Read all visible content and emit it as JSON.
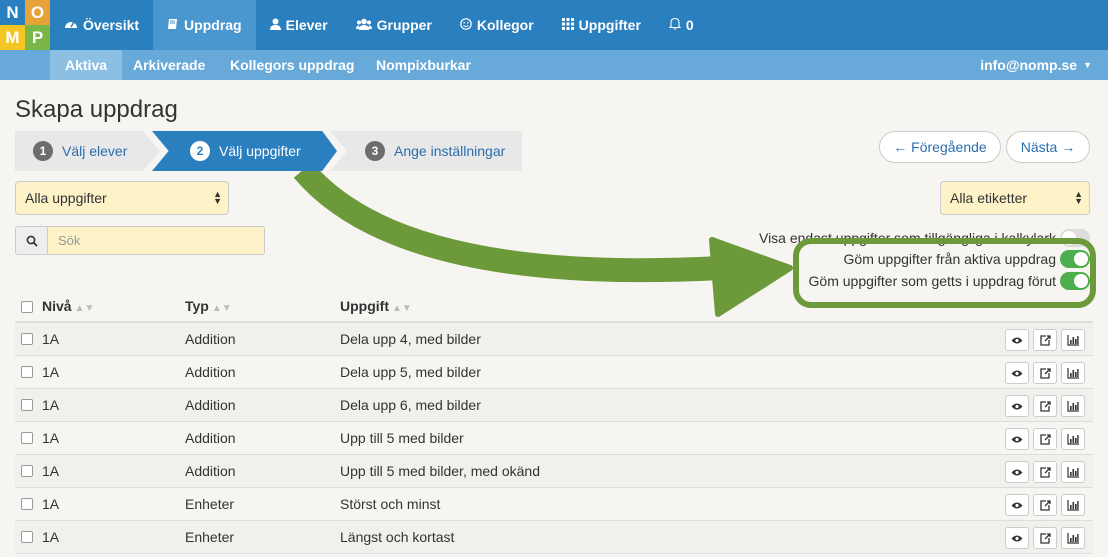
{
  "logo": {
    "letters": [
      "N",
      "O",
      "M",
      "P"
    ],
    "colors": [
      "#2a7fbf",
      "#e8a23a",
      "#f3c623",
      "#7ab648"
    ]
  },
  "nav": {
    "items": [
      {
        "label": "Översikt",
        "icon": "dashboard-icon"
      },
      {
        "label": "Uppdrag",
        "icon": "book-icon"
      },
      {
        "label": "Elever",
        "icon": "user-icon"
      },
      {
        "label": "Grupper",
        "icon": "users-icon"
      },
      {
        "label": "Kollegor",
        "icon": "smile-icon"
      },
      {
        "label": "Uppgifter",
        "icon": "grid-icon"
      },
      {
        "label": "0",
        "icon": "bell-icon"
      }
    ]
  },
  "subnav": {
    "items": [
      "Aktiva",
      "Arkiverade",
      "Kollegors uppdrag",
      "Nompixburkar"
    ],
    "user": "info@nomp.se"
  },
  "page": {
    "title": "Skapa uppdrag"
  },
  "wizard": {
    "steps": [
      {
        "num": "1",
        "label": "Välj elever"
      },
      {
        "num": "2",
        "label": "Välj uppgifter"
      },
      {
        "num": "3",
        "label": "Ange inställningar"
      }
    ],
    "prev": "← Föregående",
    "next": "Nästa →"
  },
  "filters": {
    "tasks": "Alla uppgifter",
    "tags": "Alla etiketter",
    "search_placeholder": "Sök"
  },
  "toggles": [
    {
      "label": "Visa endast uppgifter som tillgängliga i kalkylark",
      "on": false
    },
    {
      "label": "Göm uppgifter från aktiva uppdrag",
      "on": true
    },
    {
      "label": "Göm uppgifter som getts i uppdrag förut",
      "on": true
    }
  ],
  "table": {
    "headers": [
      "Nivå",
      "Typ",
      "Uppgift"
    ],
    "rows": [
      {
        "level": "1A",
        "type": "Addition",
        "task": "Dela upp 4, med bilder"
      },
      {
        "level": "1A",
        "type": "Addition",
        "task": "Dela upp 5, med bilder"
      },
      {
        "level": "1A",
        "type": "Addition",
        "task": "Dela upp 6, med bilder"
      },
      {
        "level": "1A",
        "type": "Addition",
        "task": "Upp till 5 med bilder"
      },
      {
        "level": "1A",
        "type": "Addition",
        "task": "Upp till 5 med bilder, med okänd"
      },
      {
        "level": "1A",
        "type": "Enheter",
        "task": "Störst och minst"
      },
      {
        "level": "1A",
        "type": "Enheter",
        "task": "Längst och kortast"
      }
    ]
  }
}
